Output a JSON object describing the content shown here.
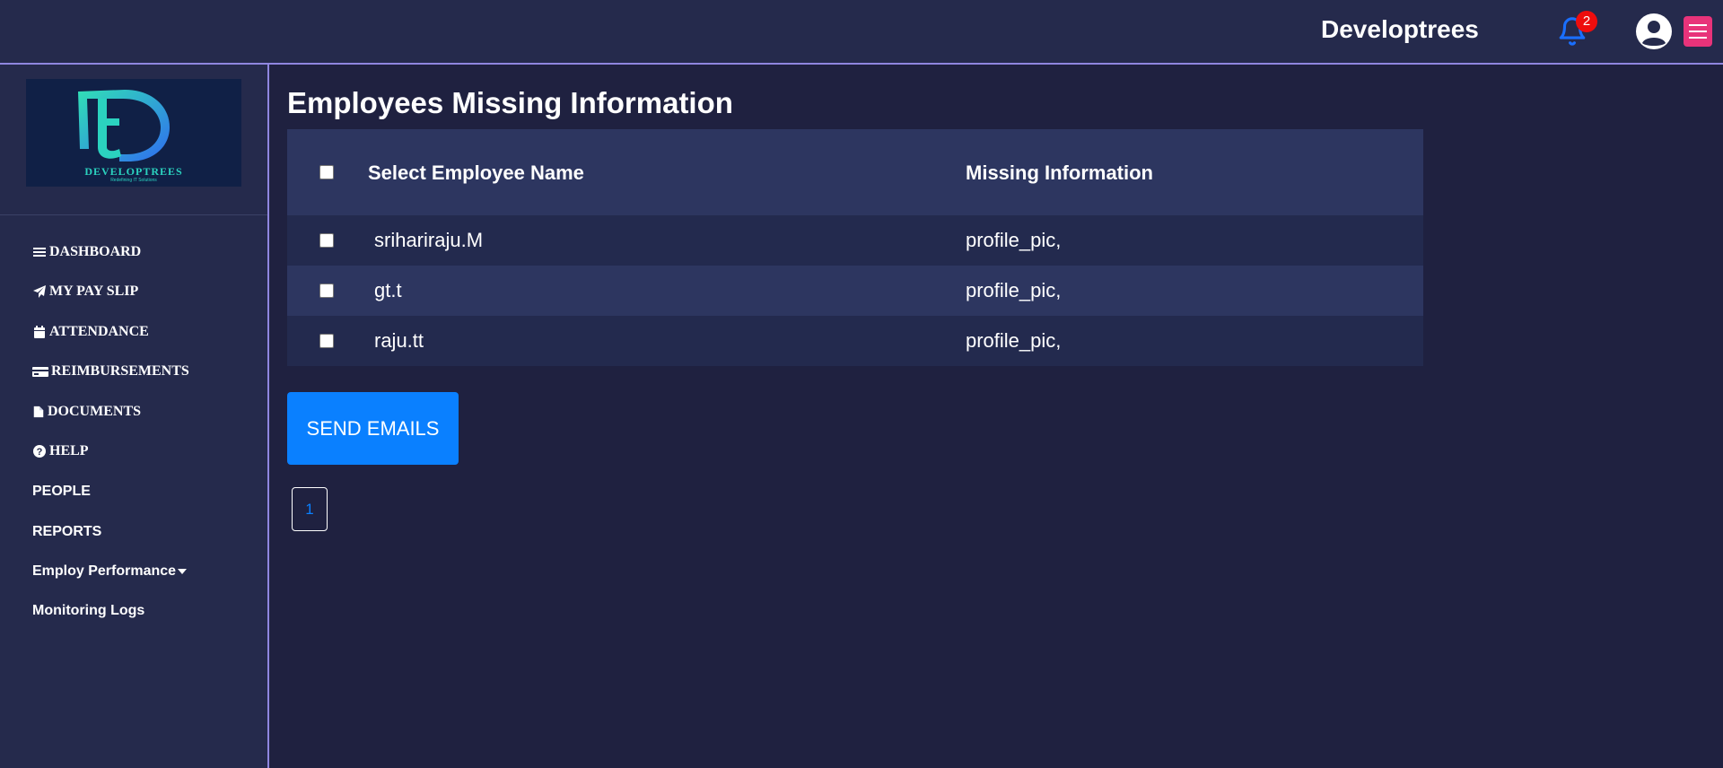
{
  "header": {
    "brand": "Developtrees",
    "notification_count": "2",
    "bell_icon": "bell-icon",
    "user_icon": "user-circle-icon",
    "menu_icon": "hamburger-menu-icon"
  },
  "sidebar": {
    "logo": {
      "letters": "Dt",
      "caption": "DEVELOPTREES",
      "tagline": "Redefining IT Solutions"
    },
    "items": [
      {
        "label": "DASHBOARD",
        "icon": "bars-icon"
      },
      {
        "label": "MY PAY SLIP",
        "icon": "paper-plane-icon"
      },
      {
        "label": "ATTENDANCE",
        "icon": "calendar-icon"
      },
      {
        "label": "REIMBURSEMENTS",
        "icon": "credit-card-icon"
      },
      {
        "label": "DOCUMENTS",
        "icon": "file-icon"
      },
      {
        "label": "HELP",
        "icon": "question-circle-icon"
      },
      {
        "label": "PEOPLE"
      },
      {
        "label": "REPORTS"
      },
      {
        "label": "Employ Performance",
        "icon": "caret-down-icon"
      },
      {
        "label": "Monitoring Logs"
      }
    ]
  },
  "main": {
    "title": "Employees Missing Information",
    "table": {
      "headers": [
        "Select Employee Name",
        "Missing Information"
      ],
      "rows": [
        {
          "name": "srihariraju.M",
          "missing": "profile_pic,"
        },
        {
          "name": "gt.t",
          "missing": "profile_pic,"
        },
        {
          "name": "raju.tt",
          "missing": "profile_pic,"
        }
      ]
    },
    "send_button": "SEND EMAILS",
    "pagination": [
      "1"
    ]
  },
  "colors": {
    "background": "#1f2140",
    "panel": "#252a4c",
    "accent": "#0a80ff",
    "border": "#8f86e0",
    "badge": "#ee0d0d",
    "menu": "#e8337a"
  }
}
